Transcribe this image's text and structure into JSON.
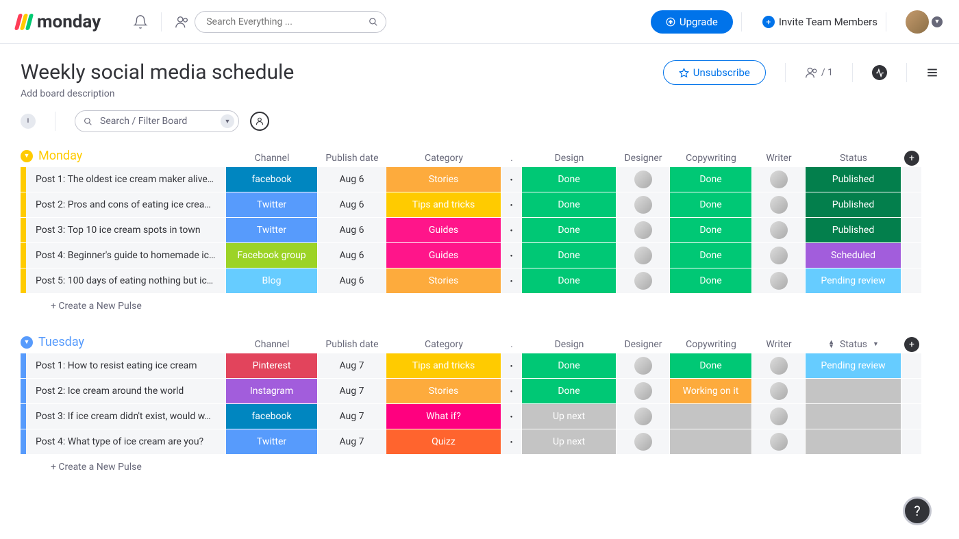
{
  "header": {
    "logo_text": "monday",
    "search_placeholder": "Search Everything ...",
    "upgrade_label": "Upgrade",
    "invite_label": "Invite Team Members"
  },
  "board": {
    "title": "Weekly social media schedule",
    "description_placeholder": "Add board description",
    "unsubscribe_label": "Unsubscribe",
    "members_count": "/ 1",
    "filter_placeholder": "Search / Filter Board",
    "new_pulse_label": "+ Create a New Pulse"
  },
  "columns": {
    "channel": "Channel",
    "publish_date": "Publish date",
    "category": "Category",
    "dot": ".",
    "design": "Design",
    "designer": "Designer",
    "copywriting": "Copywriting",
    "writer": "Writer",
    "status": "Status"
  },
  "colors": {
    "monday": "#ffcb00",
    "tuesday": "#579bfc",
    "facebook": "#0086c0",
    "twitter": "#579bfc",
    "facebook_group": "#9cd326",
    "blog": "#66ccff",
    "pinterest": "#e2445c",
    "instagram": "#a25ddc",
    "stories": "#fdab3d",
    "tips": "#ffcb00",
    "guides": "#ff158a",
    "whatif": "#ff007f",
    "quizz": "#ff642e",
    "done": "#00c875",
    "working": "#fdab3d",
    "upnext": "#c4c4c4",
    "published": "#037f4c",
    "scheduled": "#a25ddc",
    "pending": "#66ccff",
    "empty": "#c4c4c4"
  },
  "groups": [
    {
      "id": "monday",
      "title": "Monday",
      "color_key": "monday",
      "rows": [
        {
          "name": "Post 1: The oldest ice cream maker alive…",
          "channel": "facebook",
          "channel_color": "facebook",
          "date": "Aug 6",
          "category": "Stories",
          "category_color": "stories",
          "design": "Done",
          "design_color": "done",
          "copy": "Done",
          "copy_color": "done",
          "status": "Published",
          "status_color": "published"
        },
        {
          "name": "Post 2: Pros and cons of eating ice crea…",
          "channel": "Twitter",
          "channel_color": "twitter",
          "date": "Aug 6",
          "category": "Tips and tricks",
          "category_color": "tips",
          "design": "Done",
          "design_color": "done",
          "copy": "Done",
          "copy_color": "done",
          "status": "Published",
          "status_color": "published"
        },
        {
          "name": "Post 3: Top 10 ice cream spots in town",
          "channel": "Twitter",
          "channel_color": "twitter",
          "date": "Aug 6",
          "category": "Guides",
          "category_color": "guides",
          "design": "Done",
          "design_color": "done",
          "copy": "Done",
          "copy_color": "done",
          "status": "Published",
          "status_color": "published"
        },
        {
          "name": "Post 4: Beginner's guide to homemade ic…",
          "channel": "Facebook group",
          "channel_color": "facebook_group",
          "date": "Aug 6",
          "category": "Guides",
          "category_color": "guides",
          "design": "Done",
          "design_color": "done",
          "copy": "Done",
          "copy_color": "done",
          "status": "Scheduled",
          "status_color": "scheduled"
        },
        {
          "name": "Post 5: 100 days of eating nothing but ic…",
          "channel": "Blog",
          "channel_color": "blog",
          "date": "Aug 6",
          "category": "Stories",
          "category_color": "stories",
          "design": "Done",
          "design_color": "done",
          "copy": "Done",
          "copy_color": "done",
          "status": "Pending review",
          "status_color": "pending"
        }
      ]
    },
    {
      "id": "tuesday",
      "title": "Tuesday",
      "color_key": "tuesday",
      "has_status_sort": true,
      "rows": [
        {
          "name": "Post 1: How to resist eating ice cream",
          "channel": "Pinterest",
          "channel_color": "pinterest",
          "date": "Aug 7",
          "category": "Tips and tricks",
          "category_color": "tips",
          "design": "Done",
          "design_color": "done",
          "copy": "Done",
          "copy_color": "done",
          "status": "Pending review",
          "status_color": "pending"
        },
        {
          "name": "Post 2: Ice cream around the world",
          "channel": "Instagram",
          "channel_color": "instagram",
          "date": "Aug 7",
          "category": "Stories",
          "category_color": "stories",
          "design": "Done",
          "design_color": "done",
          "copy": "Working on it",
          "copy_color": "working",
          "status": "",
          "status_color": "empty"
        },
        {
          "name": "Post 3: If ice cream didn't exist, would w…",
          "channel": "facebook",
          "channel_color": "facebook",
          "date": "Aug 7",
          "category": "What if?",
          "category_color": "whatif",
          "design": "Up next",
          "design_color": "upnext",
          "copy": "",
          "copy_color": "empty",
          "status": "",
          "status_color": "empty"
        },
        {
          "name": "Post 4: What type of ice cream are you?",
          "channel": "Twitter",
          "channel_color": "twitter",
          "date": "Aug 7",
          "category": "Quizz",
          "category_color": "quizz",
          "design": "Up next",
          "design_color": "upnext",
          "copy": "",
          "copy_color": "empty",
          "status": "",
          "status_color": "empty"
        }
      ]
    }
  ]
}
